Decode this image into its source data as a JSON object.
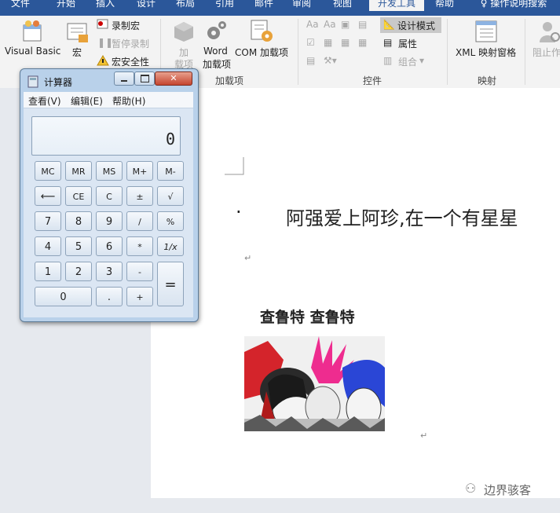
{
  "ribbon_tabs": [
    "文件",
    "开始",
    "插入",
    "设计",
    "布局",
    "引用",
    "邮件",
    "审阅",
    "视图",
    "开发工具",
    "帮助",
    "操作说明搜索"
  ],
  "ribbon": {
    "code": {
      "visual_basic": "Visual Basic",
      "macros": "宏",
      "record_macro": "录制宏",
      "pause_recording": "暂停录制",
      "macro_security": "宏安全性"
    },
    "addins": {
      "addin_1": "加",
      "addin_2": "载项",
      "word_1": "Word",
      "word_2": "加载项",
      "com": "COM 加载项",
      "group_label": "加载项"
    },
    "controls": {
      "design_mode": "设计模式",
      "properties": "属性",
      "group": "组合",
      "group_label": "控件"
    },
    "mapping": {
      "xml_pane": "XML 映射窗格",
      "group_label": "映射"
    },
    "protect": {
      "block": "阻止作"
    }
  },
  "calculator": {
    "title": "计算器",
    "menu": [
      "查看(V)",
      "编辑(E)",
      "帮助(H)"
    ],
    "display": "0",
    "keys": {
      "mc": "MC",
      "mr": "MR",
      "ms": "MS",
      "mplus": "M+",
      "mminus": "M-",
      "back": "⟵",
      "ce": "CE",
      "c": "C",
      "neg": "±",
      "sqrt": "√",
      "n7": "7",
      "n8": "8",
      "n9": "9",
      "div": "/",
      "pct": "%",
      "n4": "4",
      "n5": "5",
      "n6": "6",
      "mul": "*",
      "recip": "1/x",
      "n1": "1",
      "n2": "2",
      "n3": "3",
      "sub": "-",
      "eq": "=",
      "n0": "0",
      "dot": ".",
      "add": "+"
    }
  },
  "document": {
    "bullet": "·",
    "line1": "阿强爱上阿珍,在一个有星星",
    "para_mark_1": "↵",
    "heading": "查鲁特 查鲁特",
    "para_mark_2": "↵"
  },
  "watermark": "边界骇客",
  "colors": {
    "ribbon_blue": "#2b579a",
    "calc_frame": "#b9d1ea",
    "close_red": "#c5452f"
  }
}
